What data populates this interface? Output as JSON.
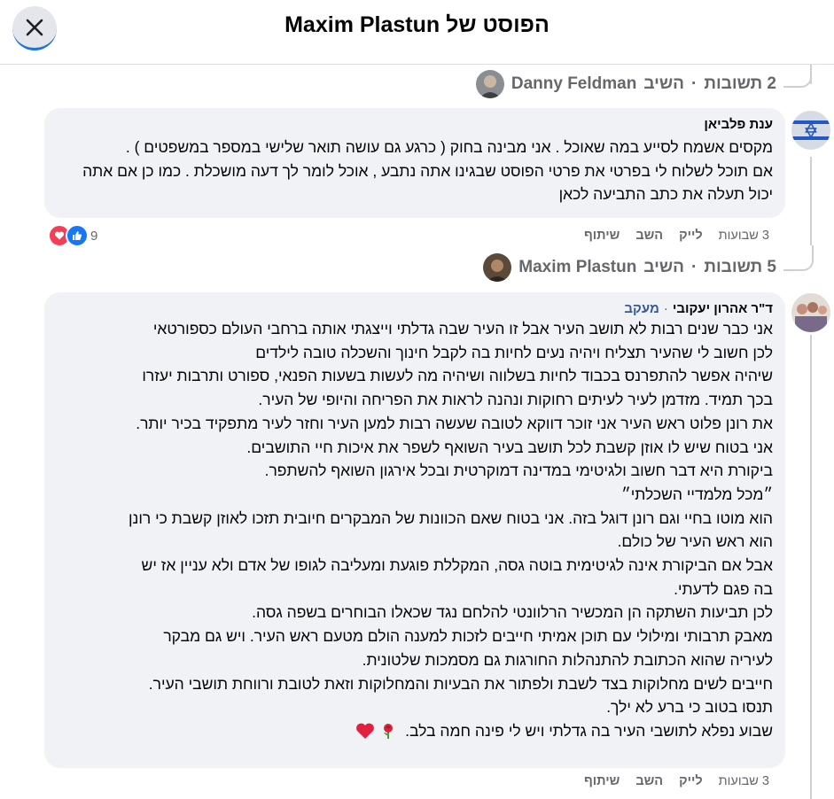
{
  "header": {
    "title": "הפוסט של Maxim Plastun",
    "close_icon": "close-icon"
  },
  "thread1": {
    "replier": "Danny Feldman",
    "label": "השיב",
    "sep": "·",
    "count": "2 תשובות"
  },
  "comment1": {
    "author": "ענת פלביאן",
    "lines": [
      "מקסים אשמח לסייע במה שאוכל . אני מבינה בחוק ( כרגע גם עושה תואר שלישי במספר במשפטים ) .",
      "אם תוכל לשלוח לי בפרטי את פרטי הפוסט שבגינו אתה נתבע , אוכל לומר לך דעה מושכלת . כמו כן אם אתה",
      "יכול תעלה את כתב התביעה לכאן"
    ],
    "time": "3 שבועות",
    "like": "לייק",
    "reply": "השב",
    "share": "שיתוף",
    "reaction_count": "9"
  },
  "thread2": {
    "replier": "Maxim Plastun",
    "label": "השיב",
    "sep": "·",
    "count": "5 תשובות"
  },
  "comment2": {
    "author": "ד\"ר אהרון יעקובי",
    "sep": "·",
    "follow": "מעקב",
    "lines": [
      "אני כבר שנים רבות לא תושב העיר אבל זו העיר שבה גדלתי וייצגתי אותה ברחבי העולם כספורטאי",
      "לכן חשוב לי שהעיר תצליח ויהיה נעים לחיות בה לקבל חינוך והשכלה טובה לילדים",
      "שיהיה אפשר להתפרנס בכבוד לחיות בשלווה ושיהיה מה לעשות בשעות הפנאי, ספורט ותרבות יעזרו",
      "בכך תמיד. מזדמן לעיר לעיתים רחוקות ונהנה לראות את הפריחה והיופי של העיר.",
      "את רונן פלוט ראש העיר אני זוכר דווקא לטובה שעשה רבות למען העיר וחזר לעיר מתפקיד בכיר יותר.",
      "אני בטוח שיש לו אוזן קשבת לכל תושב בעיר השואף לשפר את איכות חיי התושבים.",
      "ביקורת היא דבר חשוב ולגיטימי במדינה דמוקרטית ובכל אירגון השואף להשתפר.",
      "״מכל מלמדיי השכלתי״",
      "הוא מוטו בחיי וגם רונן דוגל בזה. אני בטוח שאם הכוונות של המבקרים חיובית תזכו לאוזן קשבת כי רונן",
      "הוא ראש העיר של כולם.",
      "אבל אם הביקורת אינה לגיטימית בוטה גסה, המקללת פוגעת ומעליבה לגופו של אדם ולא עניין אז יש",
      "בה פגם לדעתי.",
      "לכן תביעות השתקה הן המכשיר הרלוונטי להלחם נגד שכאלו הבוחרים בשפה גסה.",
      "מאבק תרבותי ומילולי עם תוכן אמיתי חייבים לזכות למענה הולם מטעם ראש העיר. ויש גם מבקר",
      "לעיריה שהוא הכתובת להתנהלות החורגות גם מסמכות שלטונית.",
      "חייבים לשים מחלוקות בצד לשבת ולפתור את הבעיות והמחלוקות וזאת לטובת ורווחת תושבי העיר.",
      "תנסו בטוב כי ברע לא ילך.",
      "שבוע נפלא לתושבי העיר בה גדלתי ויש לי פינה חמה בלב."
    ],
    "emojis": [
      "rose-emoji",
      "heart-emoji"
    ],
    "time": "3 שבועות",
    "like": "לייק",
    "reply": "השב",
    "share": "שיתוף"
  }
}
